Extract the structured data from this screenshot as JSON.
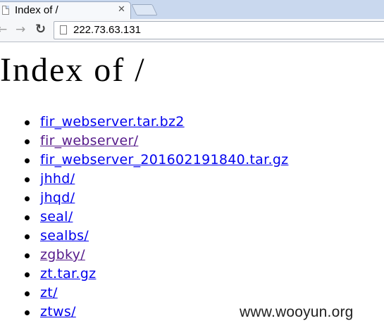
{
  "browser": {
    "tab_title": "Index of /",
    "tab_close": "✕",
    "url": "222.73.63.131",
    "back_icon": "arrow-left",
    "forward_icon": "arrow-right",
    "reload_icon": "reload"
  },
  "page": {
    "heading": "Index of /",
    "entries": [
      {
        "name": "fir_webserver.tar.bz2",
        "visited": false
      },
      {
        "name": "fir_webserver/",
        "visited": true
      },
      {
        "name": "fir_webserver_201602191840.tar.gz",
        "visited": false
      },
      {
        "name": "jhhd/",
        "visited": false
      },
      {
        "name": "jhqd/",
        "visited": false
      },
      {
        "name": "seal/",
        "visited": false
      },
      {
        "name": "sealbs/",
        "visited": false
      },
      {
        "name": "zgbky/",
        "visited": true
      },
      {
        "name": "zt.tar.gz",
        "visited": false
      },
      {
        "name": "zt/",
        "visited": false
      },
      {
        "name": "ztws/",
        "visited": false
      }
    ]
  },
  "watermark": "www.wooyun.org",
  "colors": {
    "link": "#0000ee",
    "visited_link": "#551a8b",
    "tabstrip": "#c9d8ee"
  }
}
